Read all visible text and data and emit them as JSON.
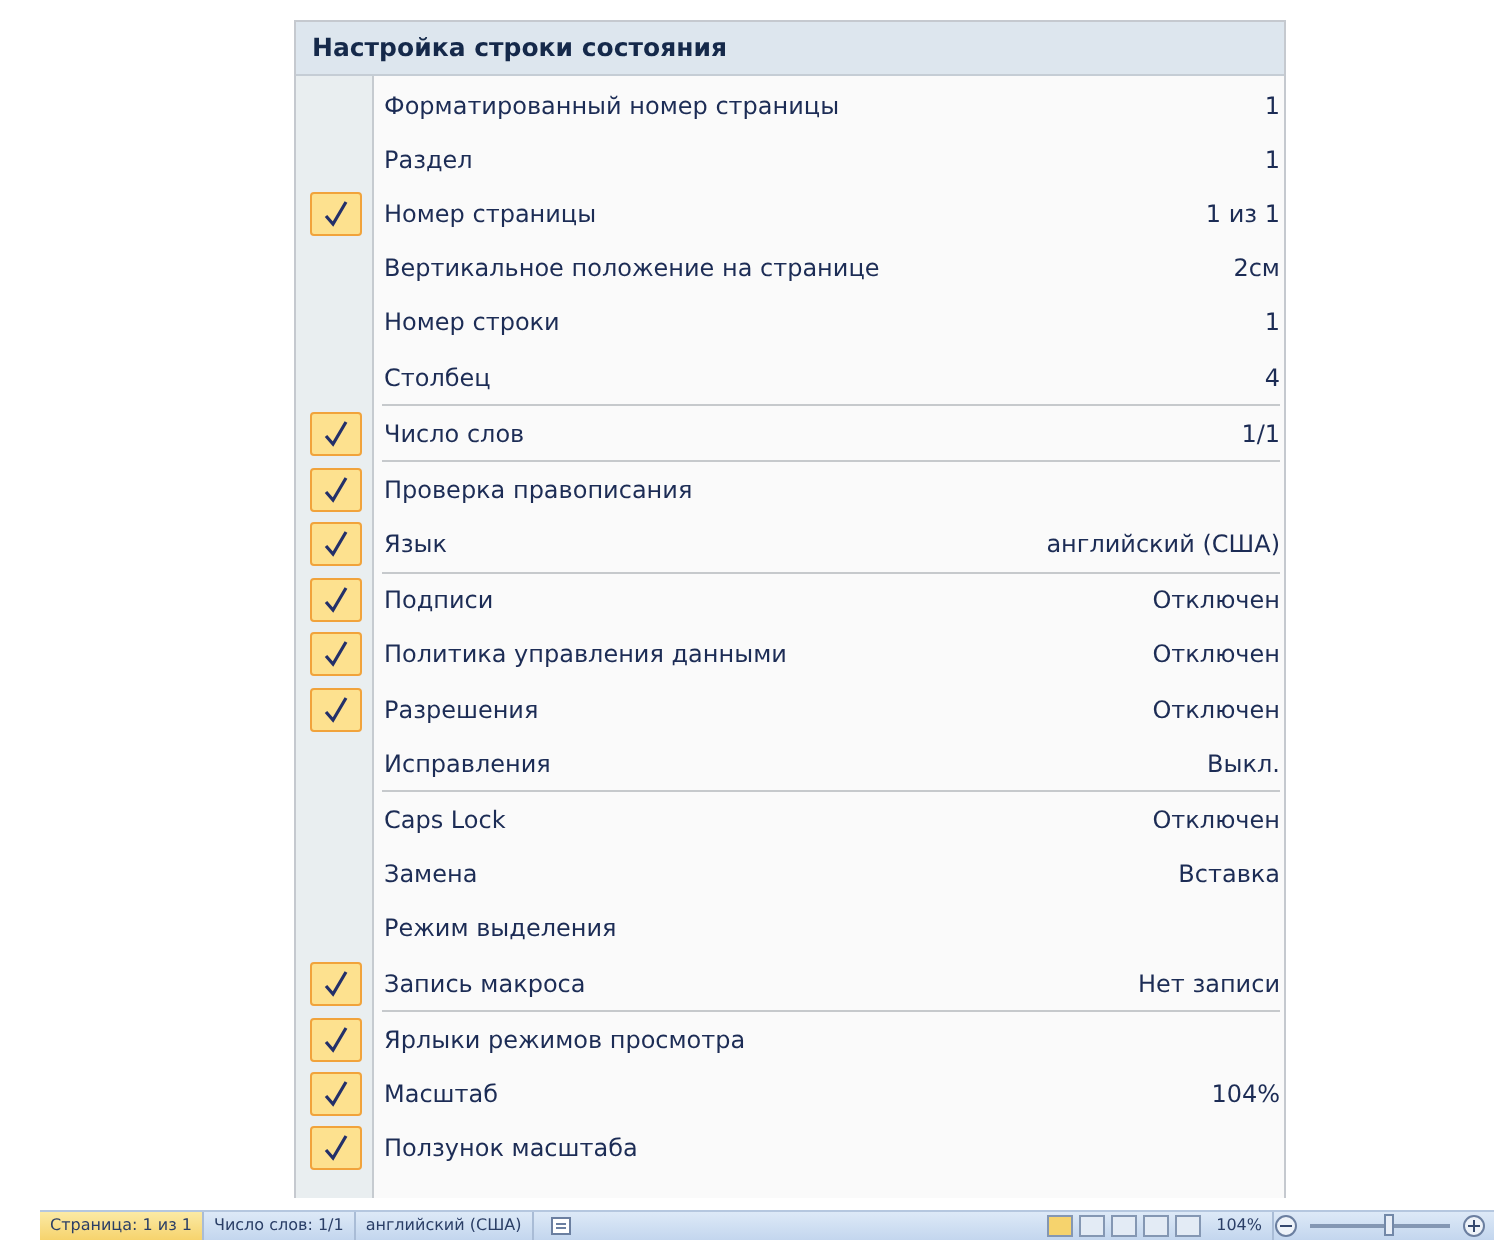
{
  "menu": {
    "title": "Настройка строки состояния",
    "groups": [
      [
        {
          "label": "Форматированный номер страницы",
          "value": "1",
          "checked": false
        },
        {
          "label": "Раздел",
          "value": "1",
          "checked": false
        },
        {
          "label": "Номер страницы",
          "value": "1 из 1",
          "checked": true
        },
        {
          "label": "Вертикальное положение на странице",
          "value": "2см",
          "checked": false
        },
        {
          "label": "Номер строки",
          "value": "1",
          "checked": false
        },
        {
          "label": "Столбец",
          "value": "4",
          "checked": false
        }
      ],
      [
        {
          "label": "Число слов",
          "value": "1/1",
          "checked": true
        }
      ],
      [
        {
          "label": "Проверка правописания",
          "checked": true
        },
        {
          "label": "Язык",
          "value": "английский (США)",
          "checked": true
        }
      ],
      [
        {
          "label": "Подписи",
          "value": "Отключен",
          "checked": true
        },
        {
          "label": "Политика управления данными",
          "value": "Отключен",
          "checked": true
        },
        {
          "label": "Разрешения",
          "value": "Отключен",
          "checked": true
        },
        {
          "label": "Исправления",
          "value": "Выкл.",
          "checked": false
        }
      ],
      [
        {
          "label": "Caps Lock",
          "value": "Отключен",
          "checked": false
        },
        {
          "label": "Замена",
          "value": "Вставка",
          "checked": false
        },
        {
          "label": "Режим выделения",
          "checked": false
        },
        {
          "label": "Запись макроса",
          "value": "Нет записи",
          "checked": true
        }
      ],
      [
        {
          "label": "Ярлыки режимов просмотра",
          "checked": true
        },
        {
          "label": "Масштаб",
          "value": "104%",
          "checked": true
        },
        {
          "label": "Ползунок масштаба",
          "checked": true
        }
      ]
    ]
  },
  "status_bar": {
    "page": "Страница: 1 из 1",
    "words": "Число слов: 1/1",
    "language": "английский (США)",
    "zoom": "104%",
    "zoom_slider": {
      "level": 0.55
    }
  }
}
